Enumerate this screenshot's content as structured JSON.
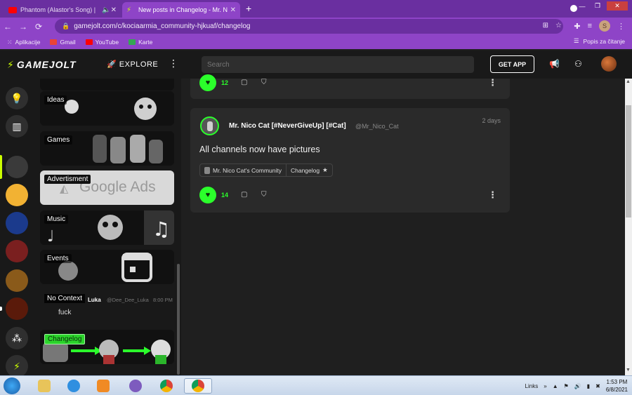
{
  "browser": {
    "tabs": [
      {
        "title": "Phantom (Alastor's Song) | H",
        "icon": "youtube-icon"
      },
      {
        "title": "New posts in Changelog - Mr. N",
        "icon": "gamejolt-icon"
      }
    ],
    "url": "gamejolt.com/c/kociaarmia_community-hjkuaf/changelog",
    "profile_initial": "S",
    "bookmarks": [
      {
        "label": "Aplikacije",
        "icon": "apps-grid-icon",
        "color": "#f5ecfc"
      },
      {
        "label": "Gmail",
        "icon": "gmail-icon",
        "color": "#ea4335"
      },
      {
        "label": "YouTube",
        "icon": "youtube-icon",
        "color": "#ff0000"
      },
      {
        "label": "Karte",
        "icon": "maps-icon",
        "color": "#34a853"
      }
    ],
    "reading_list": "Popis za čitanje"
  },
  "gamejolt": {
    "logo": "GAMEJOLT",
    "explore": "EXPLORE",
    "search_placeholder": "Search",
    "get_app": "GET APP"
  },
  "channels": [
    {
      "label": "Ideas"
    },
    {
      "label": "Games"
    },
    {
      "label": "Advertisment",
      "art_text": "Google Ads"
    },
    {
      "label": "Music"
    },
    {
      "label": "Events"
    },
    {
      "label": "No Context",
      "author": "Luka",
      "handle": "@Dee_Dee_Luka",
      "time": "8:00 PM",
      "message": "fuck"
    },
    {
      "label": "Changelog"
    }
  ],
  "feed": {
    "prev_post": {
      "likes": "12"
    },
    "post": {
      "author": "Mr. Nico Cat [#NeverGiveUp] [#Cat]",
      "handle": "@Mr_Nico_Cat",
      "time": "2 days",
      "body": "All channels now have pictures",
      "community": "Mr. Nico Cat's Community",
      "channel": "Changelog",
      "likes": "14"
    }
  },
  "taskbar": {
    "links": "Links",
    "time": "1:53 PM",
    "date": "6/8/2021"
  },
  "colors": {
    "chrome_dark": "#6a2fa0",
    "chrome_light": "#8e44c7",
    "gj_green": "#2bff2b",
    "gj_accent": "#ccff00"
  }
}
